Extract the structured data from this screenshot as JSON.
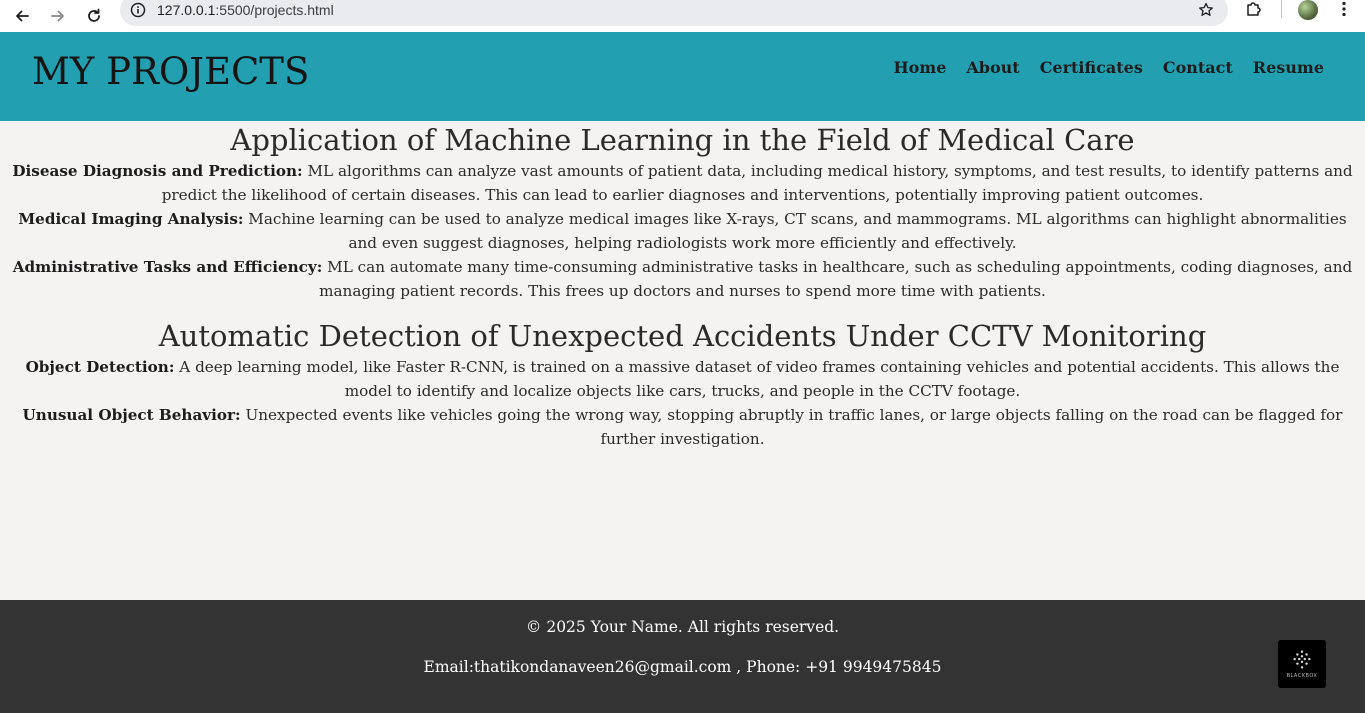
{
  "browser": {
    "url_host": "127.0.0.1",
    "url_rest": ":5500/projects.html"
  },
  "header": {
    "title": "MY PROJECTS",
    "nav": [
      "Home",
      "About",
      "Certificates",
      "Contact",
      "Resume"
    ],
    "background_color": "#22a0b1"
  },
  "sections": [
    {
      "title": "Application of Machine Learning in the Field of Medical Care",
      "items": [
        {
          "term": "Disease Diagnosis and Prediction:",
          "text": " ML algorithms can analyze vast amounts of patient data, including medical history, symptoms, and test results, to identify patterns and predict the likelihood of certain diseases. This can lead to earlier diagnoses and interventions, potentially improving patient outcomes."
        },
        {
          "term": "Medical Imaging Analysis:",
          "text": " Machine learning can be used to analyze medical images like X-rays, CT scans, and mammograms. ML algorithms can highlight abnormalities and even suggest diagnoses, helping radiologists work more efficiently and effectively."
        },
        {
          "term": "Administrative Tasks and Efficiency:",
          "text": " ML can automate many time-consuming administrative tasks in healthcare, such as scheduling appointments, coding diagnoses, and managing patient records. This frees up doctors and nurses to spend more time with patients."
        }
      ]
    },
    {
      "title": "Automatic Detection of Unexpected Accidents Under CCTV Monitoring",
      "items": [
        {
          "term": "Object Detection:",
          "text": " A deep learning model, like Faster R-CNN, is trained on a massive dataset of video frames containing vehicles and potential accidents. This allows the model to identify and localize objects like cars, trucks, and people in the CCTV footage."
        },
        {
          "term": "Unusual Object Behavior:",
          "text": " Unexpected events like vehicles going the wrong way, stopping abruptly in traffic lanes, or large objects falling on the road can be flagged for further investigation."
        }
      ]
    }
  ],
  "footer": {
    "copyright": "© 2025 Your Name. All rights reserved.",
    "contact": "Email:thatikondanaveen26@gmail.com , Phone: +91 9949475845",
    "badge_label": "BLACKBOX",
    "background_color": "#333333"
  }
}
